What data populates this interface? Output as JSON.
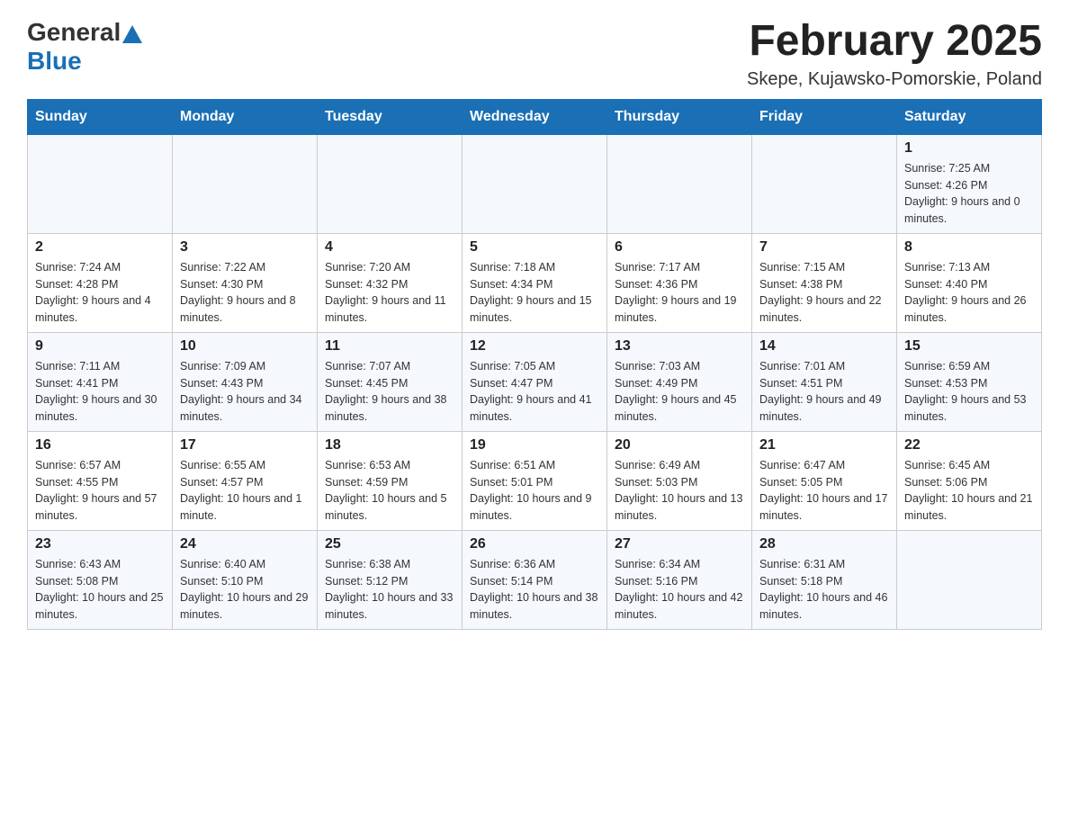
{
  "header": {
    "logo_general": "General",
    "logo_blue": "Blue",
    "month_title": "February 2025",
    "location": "Skepe, Kujawsko-Pomorskie, Poland"
  },
  "calendar": {
    "days_of_week": [
      "Sunday",
      "Monday",
      "Tuesday",
      "Wednesday",
      "Thursday",
      "Friday",
      "Saturday"
    ],
    "weeks": [
      [
        {
          "day": "",
          "info": ""
        },
        {
          "day": "",
          "info": ""
        },
        {
          "day": "",
          "info": ""
        },
        {
          "day": "",
          "info": ""
        },
        {
          "day": "",
          "info": ""
        },
        {
          "day": "",
          "info": ""
        },
        {
          "day": "1",
          "info": "Sunrise: 7:25 AM\nSunset: 4:26 PM\nDaylight: 9 hours and 0 minutes."
        }
      ],
      [
        {
          "day": "2",
          "info": "Sunrise: 7:24 AM\nSunset: 4:28 PM\nDaylight: 9 hours and 4 minutes."
        },
        {
          "day": "3",
          "info": "Sunrise: 7:22 AM\nSunset: 4:30 PM\nDaylight: 9 hours and 8 minutes."
        },
        {
          "day": "4",
          "info": "Sunrise: 7:20 AM\nSunset: 4:32 PM\nDaylight: 9 hours and 11 minutes."
        },
        {
          "day": "5",
          "info": "Sunrise: 7:18 AM\nSunset: 4:34 PM\nDaylight: 9 hours and 15 minutes."
        },
        {
          "day": "6",
          "info": "Sunrise: 7:17 AM\nSunset: 4:36 PM\nDaylight: 9 hours and 19 minutes."
        },
        {
          "day": "7",
          "info": "Sunrise: 7:15 AM\nSunset: 4:38 PM\nDaylight: 9 hours and 22 minutes."
        },
        {
          "day": "8",
          "info": "Sunrise: 7:13 AM\nSunset: 4:40 PM\nDaylight: 9 hours and 26 minutes."
        }
      ],
      [
        {
          "day": "9",
          "info": "Sunrise: 7:11 AM\nSunset: 4:41 PM\nDaylight: 9 hours and 30 minutes."
        },
        {
          "day": "10",
          "info": "Sunrise: 7:09 AM\nSunset: 4:43 PM\nDaylight: 9 hours and 34 minutes."
        },
        {
          "day": "11",
          "info": "Sunrise: 7:07 AM\nSunset: 4:45 PM\nDaylight: 9 hours and 38 minutes."
        },
        {
          "day": "12",
          "info": "Sunrise: 7:05 AM\nSunset: 4:47 PM\nDaylight: 9 hours and 41 minutes."
        },
        {
          "day": "13",
          "info": "Sunrise: 7:03 AM\nSunset: 4:49 PM\nDaylight: 9 hours and 45 minutes."
        },
        {
          "day": "14",
          "info": "Sunrise: 7:01 AM\nSunset: 4:51 PM\nDaylight: 9 hours and 49 minutes."
        },
        {
          "day": "15",
          "info": "Sunrise: 6:59 AM\nSunset: 4:53 PM\nDaylight: 9 hours and 53 minutes."
        }
      ],
      [
        {
          "day": "16",
          "info": "Sunrise: 6:57 AM\nSunset: 4:55 PM\nDaylight: 9 hours and 57 minutes."
        },
        {
          "day": "17",
          "info": "Sunrise: 6:55 AM\nSunset: 4:57 PM\nDaylight: 10 hours and 1 minute."
        },
        {
          "day": "18",
          "info": "Sunrise: 6:53 AM\nSunset: 4:59 PM\nDaylight: 10 hours and 5 minutes."
        },
        {
          "day": "19",
          "info": "Sunrise: 6:51 AM\nSunset: 5:01 PM\nDaylight: 10 hours and 9 minutes."
        },
        {
          "day": "20",
          "info": "Sunrise: 6:49 AM\nSunset: 5:03 PM\nDaylight: 10 hours and 13 minutes."
        },
        {
          "day": "21",
          "info": "Sunrise: 6:47 AM\nSunset: 5:05 PM\nDaylight: 10 hours and 17 minutes."
        },
        {
          "day": "22",
          "info": "Sunrise: 6:45 AM\nSunset: 5:06 PM\nDaylight: 10 hours and 21 minutes."
        }
      ],
      [
        {
          "day": "23",
          "info": "Sunrise: 6:43 AM\nSunset: 5:08 PM\nDaylight: 10 hours and 25 minutes."
        },
        {
          "day": "24",
          "info": "Sunrise: 6:40 AM\nSunset: 5:10 PM\nDaylight: 10 hours and 29 minutes."
        },
        {
          "day": "25",
          "info": "Sunrise: 6:38 AM\nSunset: 5:12 PM\nDaylight: 10 hours and 33 minutes."
        },
        {
          "day": "26",
          "info": "Sunrise: 6:36 AM\nSunset: 5:14 PM\nDaylight: 10 hours and 38 minutes."
        },
        {
          "day": "27",
          "info": "Sunrise: 6:34 AM\nSunset: 5:16 PM\nDaylight: 10 hours and 42 minutes."
        },
        {
          "day": "28",
          "info": "Sunrise: 6:31 AM\nSunset: 5:18 PM\nDaylight: 10 hours and 46 minutes."
        },
        {
          "day": "",
          "info": ""
        }
      ]
    ]
  }
}
